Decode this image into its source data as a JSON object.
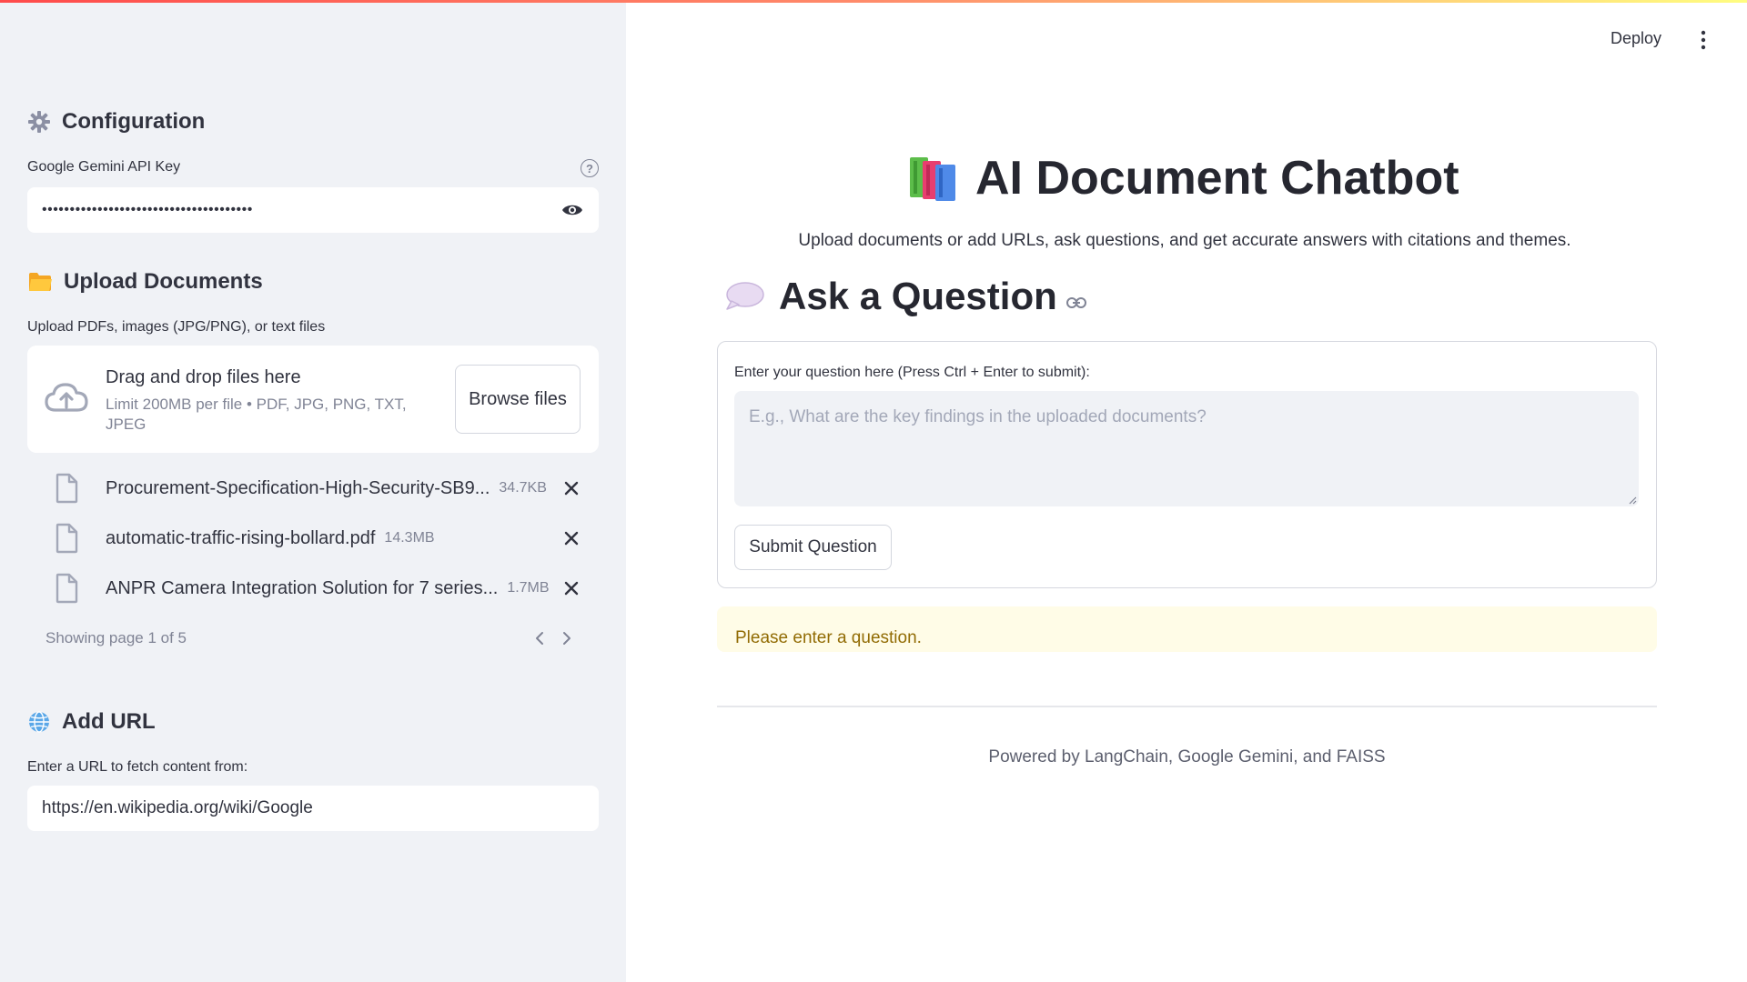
{
  "sidebar": {
    "configuration": {
      "heading": "Configuration",
      "icon": "gear-icon",
      "api_key_label": "Google Gemini API Key",
      "api_key_value": "••••••••••••••••••••••••••••••••••••••"
    },
    "upload": {
      "heading": "Upload Documents",
      "icon": "folder-icon",
      "label": "Upload PDFs, images (JPG/PNG), or text files",
      "dropzone_title": "Drag and drop files here",
      "dropzone_limit": "Limit 200MB per file • PDF, JPG, PNG, TXT, JPEG",
      "browse_label": "Browse files",
      "files": [
        {
          "name": "Procurement-Specification-High-Security-SB9...",
          "size": "34.7KB"
        },
        {
          "name": "automatic-traffic-rising-bollard.pdf",
          "size": "14.3MB"
        },
        {
          "name": "ANPR Camera Integration Solution for 7 series...",
          "size": "1.7MB"
        }
      ],
      "pager_text": "Showing page 1 of 5"
    },
    "url": {
      "heading": "Add URL",
      "icon": "globe-icon",
      "label": "Enter a URL to fetch content from:",
      "value": "https://en.wikipedia.org/wiki/Google"
    }
  },
  "header": {
    "deploy_label": "Deploy"
  },
  "main": {
    "title": "AI Document Chatbot",
    "title_icon": "books-icon",
    "subtitle": "Upload documents or add URLs, ask questions, and get accurate answers with citations and themes.",
    "ask_heading": "Ask a Question",
    "ask_icon": "speech-bubble-icon",
    "question_label": "Enter your question here (Press Ctrl + Enter to submit):",
    "question_placeholder": "E.g., What are the key findings in the uploaded documents?",
    "submit_label": "Submit Question",
    "warning_text": "Please enter a question.",
    "footer": "Powered by LangChain, Google Gemini, and FAISS"
  },
  "colors": {
    "sidebar_bg": "#f0f2f6",
    "warning_bg": "#fffce7",
    "warning_text": "#926c05",
    "accent_red": "#ff4b4b"
  }
}
